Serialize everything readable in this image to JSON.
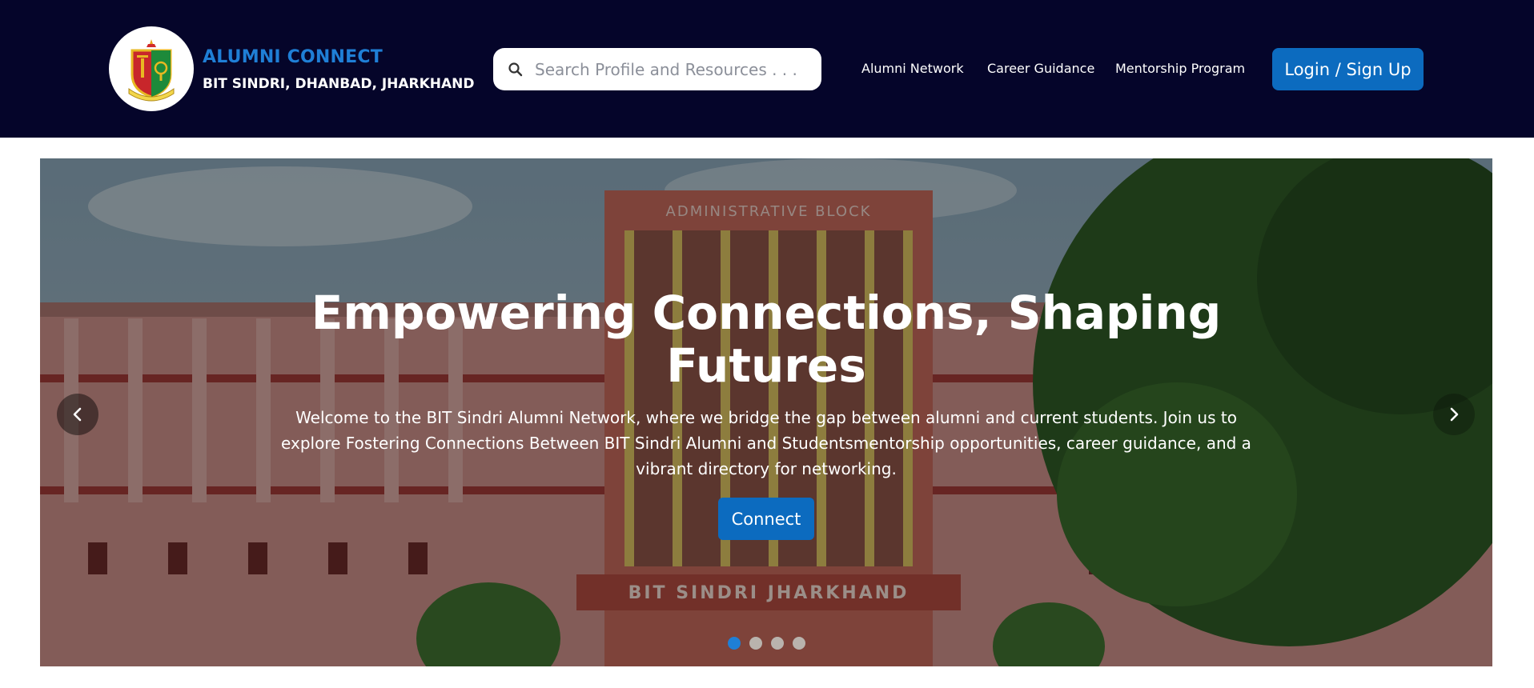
{
  "header": {
    "brand_title": "ALUMNI CONNECT",
    "brand_subtitle": "BIT SINDRI, DHANBAD, JHARKHAND",
    "logo_icon": "college-crest-icon",
    "search": {
      "placeholder": "Search Profile and Resources . . .",
      "value": "",
      "icon": "search-icon"
    },
    "nav": [
      {
        "label": "Alumni Network"
      },
      {
        "label": "Career Guidance"
      },
      {
        "label": "Mentorship Program"
      }
    ],
    "login_label": "Login / Sign Up"
  },
  "hero": {
    "title": "Empowering Connections, Shaping Futures",
    "text": "Welcome to the BIT Sindri Alumni Network, where we bridge the gap between alumni and current students. Join us to explore Fostering Connections Between BIT Sindri Alumni and Studentsmentorship opportunities, career guidance, and a vibrant directory for networking.",
    "cta_label": "Connect",
    "building_sign_top": "ADMINISTRATIVE BLOCK",
    "building_sign_bottom": "BIT SINDRI JHARKHAND",
    "carousel": {
      "slides": 4,
      "active": 1
    }
  },
  "colors": {
    "header_bg": "#05052a",
    "accent": "#0c6bbf",
    "brand_title": "#1f7fd6"
  }
}
